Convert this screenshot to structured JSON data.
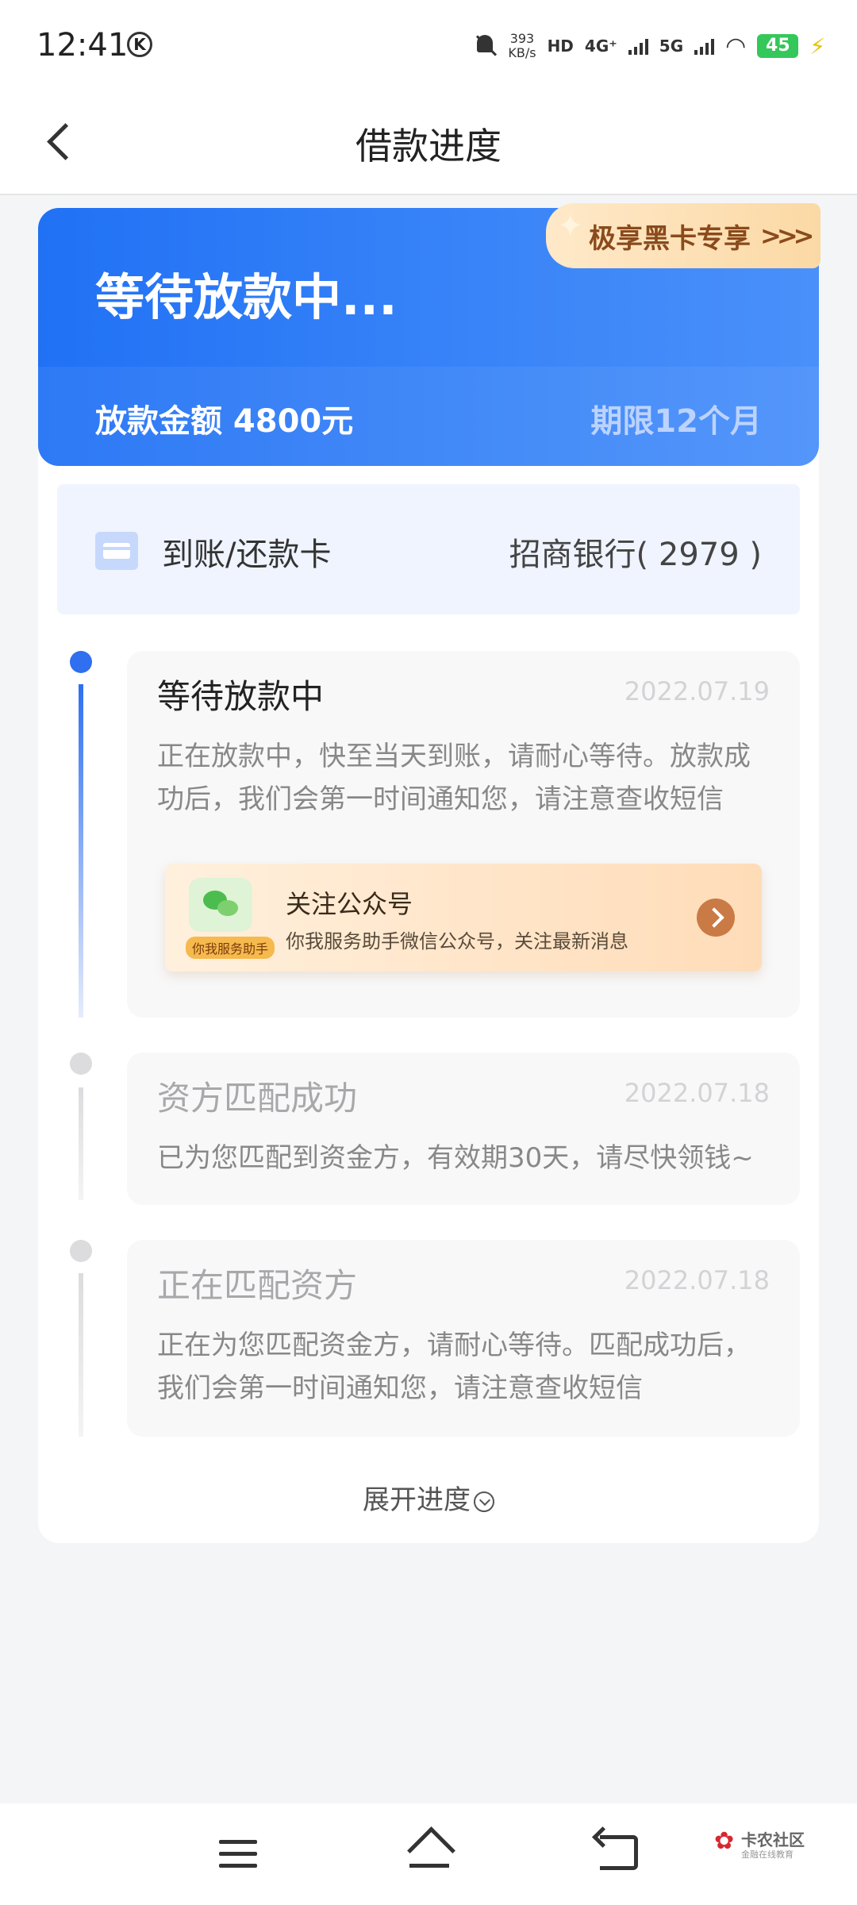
{
  "status_bar": {
    "time": "12:41",
    "k_badge": "K",
    "net_speed_value": "393",
    "net_speed_unit": "KB/s",
    "hd_label": "HD",
    "sim1": "4G⁺",
    "sim2": "5G",
    "battery": "45"
  },
  "nav": {
    "title": "借款进度"
  },
  "hero": {
    "status": "等待放款中...",
    "amount": "放款金额 4800元",
    "term": "期限12个月",
    "vip_badge": "极享黑卡专享",
    "vip_arrows": ">>>"
  },
  "card": {
    "label": "到账/还款卡",
    "bank": "招商银行( 2979 )"
  },
  "timeline": [
    {
      "title": "等待放款中",
      "date": "2022.07.19",
      "desc": "正在放款中，快至当天到账，请耐心等待。放款成功后，我们会第一时间通知您，请注意查收短信",
      "active": true
    },
    {
      "title": "资方匹配成功",
      "date": "2022.07.18",
      "desc": "已为您匹配到资金方，有效期30天，请尽快领钱~",
      "active": false
    },
    {
      "title": "正在匹配资方",
      "date": "2022.07.18",
      "desc": "正在为您匹配资金方，请耐心等待。匹配成功后，我们会第一时间通知您，请注意查收短信",
      "active": false
    }
  ],
  "follow": {
    "tag": "你我服务助手",
    "title": "关注公众号",
    "subtitle": "你我服务助手微信公众号，关注最新消息"
  },
  "expand_label": "展开进度",
  "watermark": {
    "name": "卡农社区",
    "sub": "金融在线教育"
  },
  "colors": {
    "accent": "#2171f5",
    "timeline_active": "#2f6ff0",
    "timeline_inactive": "#d8d8da"
  }
}
